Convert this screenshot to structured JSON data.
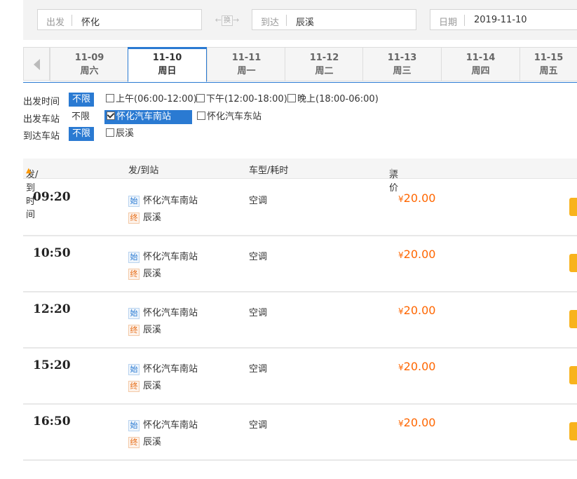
{
  "search": {
    "from_label": "出发",
    "from_value": "怀化",
    "swap_label": "换",
    "to_label": "到达",
    "to_value": "辰溪",
    "date_label": "日期",
    "date_value": "2019-11-10"
  },
  "dates": [
    {
      "date": "11-09",
      "weekday": "周六"
    },
    {
      "date": "11-10",
      "weekday": "周日"
    },
    {
      "date": "11-11",
      "weekday": "周一"
    },
    {
      "date": "11-12",
      "weekday": "周二"
    },
    {
      "date": "11-13",
      "weekday": "周三"
    },
    {
      "date": "11-14",
      "weekday": "周四"
    },
    {
      "date": "11-15",
      "weekday": "周五"
    }
  ],
  "filters": {
    "depart_time": {
      "label": "出发时间",
      "all": "不限",
      "options": [
        "上午(06:00-12:00)",
        "下午(12:00-18:00)",
        "晚上(18:00-06:00)"
      ]
    },
    "depart_station": {
      "label": "出发车站",
      "all": "不限",
      "options": [
        "怀化汽车南站",
        "怀化汽车东站"
      ]
    },
    "arrive_station": {
      "label": "到达车站",
      "all": "不限",
      "options": [
        "辰溪"
      ]
    }
  },
  "table": {
    "headers": {
      "time": "发/到时间",
      "station": "发/到站",
      "type": "车型/耗时",
      "price": "票价"
    },
    "start_tag": "始",
    "end_tag": "终",
    "currency": "¥",
    "rows": [
      {
        "time": "09:20",
        "from": "怀化汽车南站",
        "to": "辰溪",
        "type": "空调",
        "price": "20.00"
      },
      {
        "time": "10:50",
        "from": "怀化汽车南站",
        "to": "辰溪",
        "type": "空调",
        "price": "20.00"
      },
      {
        "time": "12:20",
        "from": "怀化汽车南站",
        "to": "辰溪",
        "type": "空调",
        "price": "20.00"
      },
      {
        "time": "15:20",
        "from": "怀化汽车南站",
        "to": "辰溪",
        "type": "空调",
        "price": "20.00"
      },
      {
        "time": "16:50",
        "from": "怀化汽车南站",
        "to": "辰溪",
        "type": "空调",
        "price": "20.00"
      }
    ]
  }
}
